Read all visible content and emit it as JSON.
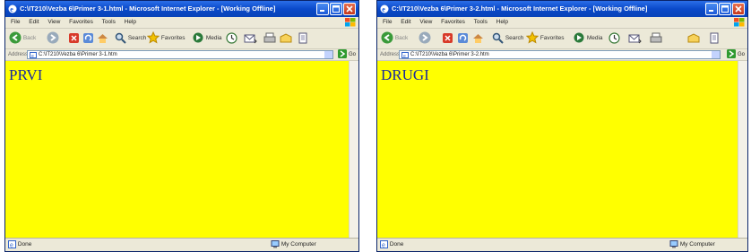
{
  "windows": [
    {
      "title": "C:\\IT210\\Vezba 6\\Primer 3-1.html - Microsoft Internet Explorer - [Working Offline]",
      "menu": [
        "File",
        "Edit",
        "View",
        "Favorites",
        "Tools",
        "Help"
      ],
      "toolbar": {
        "back": "Back",
        "search": "Search",
        "favorites": "Favorites",
        "media": "Media"
      },
      "address": {
        "label": "Address",
        "value": "C:\\IT210\\Vezba 6\\Primer 3-1.htm",
        "go": "Go"
      },
      "heading": "PRVI",
      "status": {
        "left": "Done",
        "right": "My Computer"
      }
    },
    {
      "title": "C:\\IT210\\Vezba 6\\Primer 3-2.html - Microsoft Internet Explorer - [Working Offline]",
      "menu": [
        "File",
        "Edit",
        "View",
        "Favorites",
        "Tools",
        "Help"
      ],
      "toolbar": {
        "back": "Back",
        "search": "Search",
        "favorites": "Favorites",
        "media": "Media"
      },
      "address": {
        "label": "Address",
        "value": "C:\\IT210\\Vezba 6\\Primer 3-2.htm",
        "go": "Go"
      },
      "heading": "DRUGI",
      "status": {
        "left": "Done",
        "right": "My Computer"
      }
    }
  ],
  "colors": {
    "page_background": "#ffff00",
    "heading_text": "#1a2a9c",
    "titlebar": "#0a49c9"
  },
  "icons": [
    "ie-icon",
    "minimize-icon",
    "maximize-icon",
    "close-icon",
    "windows-flag-icon",
    "back-arrow-icon",
    "forward-arrow-icon",
    "stop-icon",
    "refresh-icon",
    "home-icon",
    "search-icon",
    "favorites-star-icon",
    "media-icon",
    "history-icon",
    "mail-icon",
    "print-icon",
    "edit-icon",
    "page-icon",
    "go-arrow-icon",
    "ie-page-icon",
    "my-computer-icon"
  ]
}
